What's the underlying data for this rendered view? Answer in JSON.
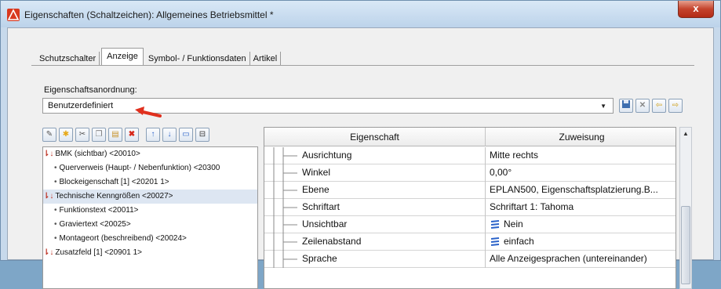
{
  "window": {
    "title": "Eigenschaften (Schaltzeichen): Allgemeines Betriebsmittel *",
    "close_label": "x"
  },
  "tabs": [
    {
      "label": "Schutzschalter",
      "active": false
    },
    {
      "label": "Anzeige",
      "active": true
    },
    {
      "label": "Symbol- / Funktionsdaten",
      "active": false
    },
    {
      "label": "Artikel",
      "active": false
    }
  ],
  "property_order": {
    "label": "Eigenschaftsanordnung:",
    "value": "Benutzerdefiniert"
  },
  "tree": {
    "items": [
      {
        "text": "BMK (sichtbar) <20010>",
        "level": 0,
        "selected": false
      },
      {
        "text": "Querverweis (Haupt- / Nebenfunktion) <20300",
        "level": 1,
        "selected": false
      },
      {
        "text": "Blockeigenschaft [1] <20201 1>",
        "level": 1,
        "selected": false
      },
      {
        "text": "Technische Kenngrößen <20027>",
        "level": 0,
        "selected": true
      },
      {
        "text": "Funktionstext <20011>",
        "level": 1,
        "selected": false
      },
      {
        "text": "Graviertext <20025>",
        "level": 1,
        "selected": false
      },
      {
        "text": "Montageort (beschreibend) <20024>",
        "level": 1,
        "selected": false
      },
      {
        "text": "Zusatzfeld [1] <20901 1>",
        "level": 0,
        "selected": false
      }
    ]
  },
  "grid": {
    "headers": {
      "property": "Eigenschaft",
      "assignment": "Zuweisung"
    },
    "rows": [
      {
        "name": "Ausrichtung",
        "value": "Mitte rechts",
        "icon": ""
      },
      {
        "name": "Winkel",
        "value": "0,00°",
        "icon": ""
      },
      {
        "name": "Ebene",
        "value": "EPLAN500, Eigenschaftsplatzierung.B...",
        "icon": ""
      },
      {
        "name": "Schriftart",
        "value": "Schriftart 1: Tahoma",
        "icon": ""
      },
      {
        "name": "Unsichtbar",
        "value": "Nein",
        "icon": "format-icon"
      },
      {
        "name": "Zeilenabstand",
        "value": "einfach",
        "icon": "format-icon"
      },
      {
        "name": "Sprache",
        "value": "Alle Anzeigesprachen (untereinander)",
        "icon": ""
      }
    ]
  },
  "colors": {
    "accent_red": "#e0301e",
    "format_icon_blue": "#2a62c9"
  }
}
